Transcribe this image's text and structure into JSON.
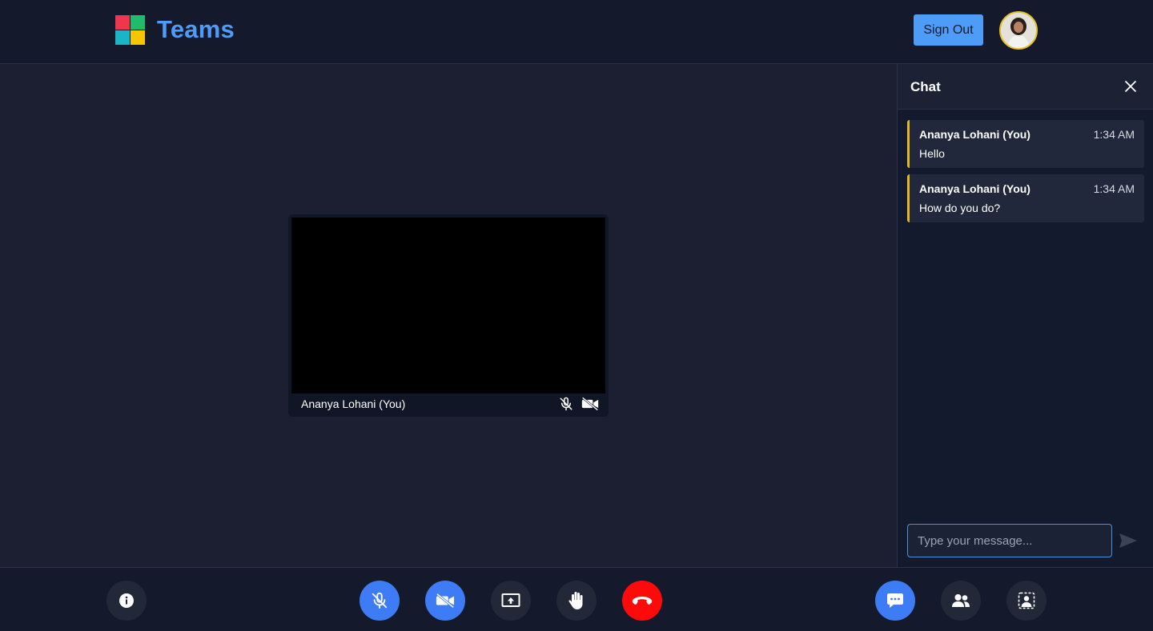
{
  "header": {
    "brand": "Teams",
    "sign_out_label": "Sign Out",
    "brand_color": "#4f9cf8",
    "logo_colors": [
      "#f0364a",
      "#1fbc6d",
      "#1ab6c8",
      "#f6c700"
    ]
  },
  "stage": {
    "participant_name": "Ananya Lohani (You)",
    "mic_status_icon": "mic-off-icon",
    "camera_status_icon": "video-off-icon"
  },
  "chat": {
    "title": "Chat",
    "messages": [
      {
        "sender": "Ananya Lohani (You)",
        "time": "1:34 AM",
        "text": "Hello"
      },
      {
        "sender": "Ananya Lohani (You)",
        "time": "1:34 AM",
        "text": "How do you do?"
      }
    ],
    "input_placeholder": "Type your message...",
    "accent": "#e2b91c"
  },
  "toolbar": {
    "buttons": [
      {
        "name": "info",
        "icon": "info-icon"
      },
      {
        "name": "mute",
        "icon": "mic-off-icon",
        "active": true
      },
      {
        "name": "camera",
        "icon": "video-off-icon",
        "active": true
      },
      {
        "name": "share-screen",
        "icon": "screen-share-icon"
      },
      {
        "name": "raise-hand",
        "icon": "hand-icon"
      },
      {
        "name": "leave-call",
        "icon": "phone-hangup-icon"
      },
      {
        "name": "chat",
        "icon": "chat-icon",
        "active": true
      },
      {
        "name": "participants",
        "icon": "people-icon"
      },
      {
        "name": "background-effects",
        "icon": "background-blur-icon"
      }
    ],
    "active_color": "#3d7cf5",
    "hangup_color": "#ff0a0a"
  }
}
